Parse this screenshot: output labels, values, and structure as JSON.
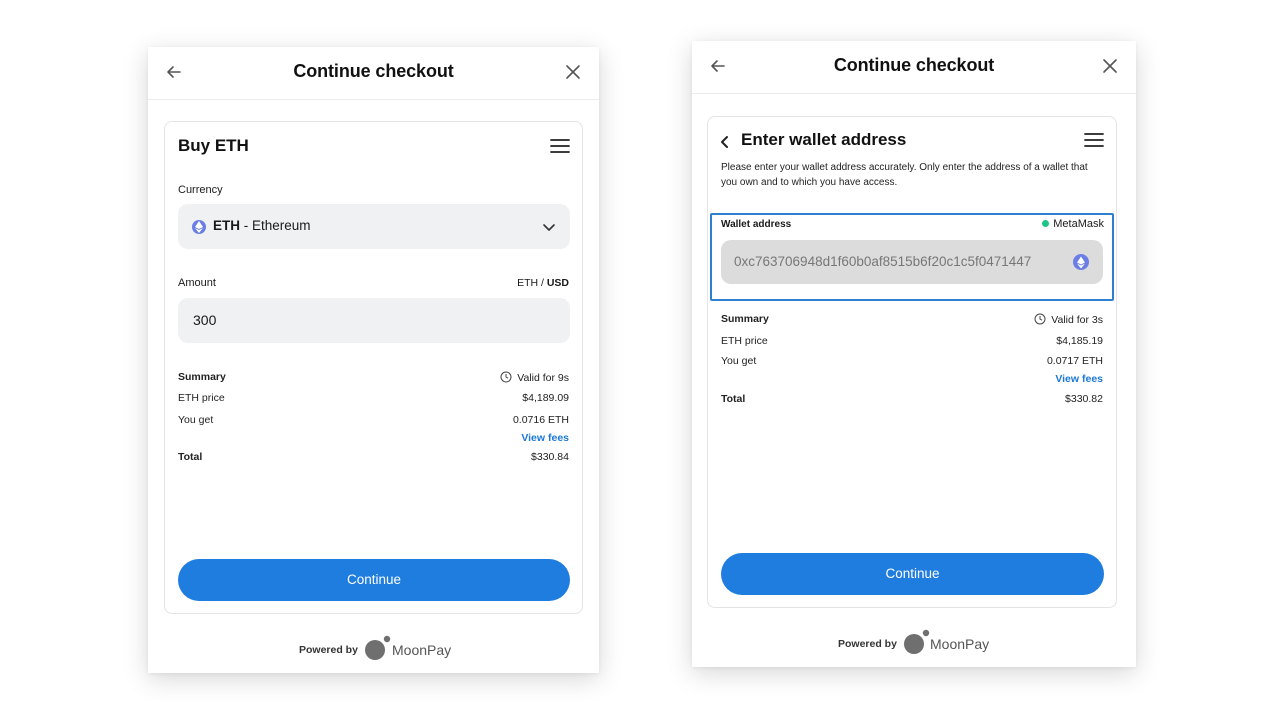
{
  "left": {
    "header": {
      "title": "Continue checkout"
    },
    "card_title": "Buy ETH",
    "currency": {
      "label": "Currency",
      "symbol": "ETH",
      "separator": " - ",
      "name": "Ethereum"
    },
    "amount": {
      "label": "Amount",
      "unit_a": "ETH",
      "unit_sep": " / ",
      "unit_b": "USD",
      "value": "300"
    },
    "summary": {
      "label": "Summary",
      "valid": "Valid for 9s",
      "eth_price_label": "ETH price",
      "eth_price": "$4,189.09",
      "you_get_label": "You get",
      "you_get": "0.0716 ETH",
      "view_fees": "View fees",
      "total_label": "Total",
      "total": "$330.84"
    },
    "continue": "Continue",
    "powered_by": "Powered by",
    "brand": "MoonPay"
  },
  "right": {
    "header": {
      "title": "Continue checkout"
    },
    "card_title": "Enter wallet address",
    "description": "Please enter your wallet address accurately. Only enter the address of a wallet that you own and to which you have access.",
    "wallet": {
      "label": "Wallet address",
      "provider": "MetaMask",
      "address": "0xc763706948d1f60b0af8515b6f20c1c5f0471447"
    },
    "summary": {
      "label": "Summary",
      "valid": "Valid for 3s",
      "eth_price_label": "ETH price",
      "eth_price": "$4,185.19",
      "you_get_label": "You get",
      "you_get": "0.0717 ETH",
      "view_fees": "View fees",
      "total_label": "Total",
      "total": "$330.82"
    },
    "continue": "Continue",
    "powered_by": "Powered by",
    "brand": "MoonPay"
  },
  "colors": {
    "accent": "#1f7de0",
    "link": "#1c79d4",
    "eth": "#6a7ee6",
    "metamask_dot": "#20c486",
    "focus_border": "#2f7fd1"
  },
  "icons": [
    "back-arrow-icon",
    "close-icon",
    "menu-icon",
    "eth-icon",
    "chevron-down-icon",
    "clock-icon",
    "chevron-left-icon",
    "moonpay-logo-icon"
  ]
}
